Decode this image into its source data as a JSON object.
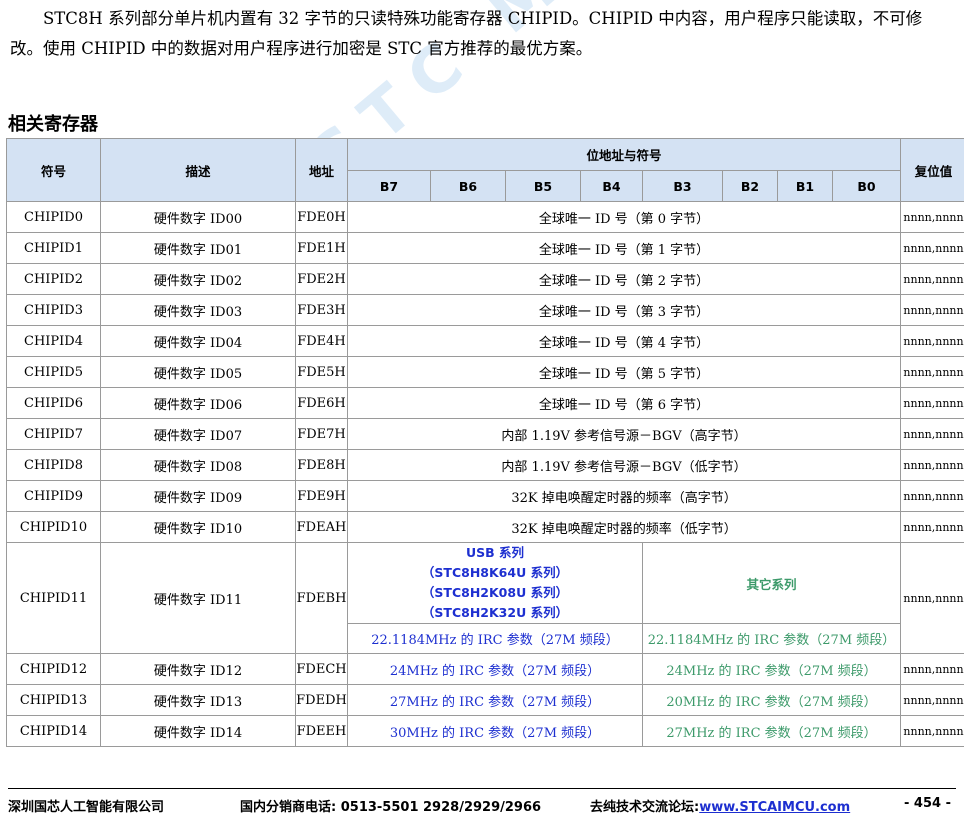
{
  "intro": "STC8H 系列部分单片机内置有 32 字节的只读特殊功能寄存器 CHIPID。CHIPID 中内容，用户程序只能读取，不可修改。使用 CHIPID 中的数据对用户程序进行加密是 STC 官方推荐的最优方案。",
  "watermark": "STC MCU",
  "section_title": "相关寄存器",
  "table": {
    "headers": {
      "symbol": "符号",
      "desc": "描述",
      "addr": "地址",
      "bits_group": "位地址与符号",
      "reset": "复位值",
      "bits": [
        "B7",
        "B6",
        "B5",
        "B4",
        "B3",
        "B2",
        "B1",
        "B0"
      ]
    },
    "rows": [
      {
        "symbol": "CHIPID0",
        "desc": "硬件数字 ID00",
        "addr": "FDE0H",
        "content": "全球唯一 ID 号（第 0 字节）",
        "reset": "nnnn,nnnn"
      },
      {
        "symbol": "CHIPID1",
        "desc": "硬件数字 ID01",
        "addr": "FDE1H",
        "content": "全球唯一 ID 号（第 1 字节）",
        "reset": "nnnn,nnnn"
      },
      {
        "symbol": "CHIPID2",
        "desc": "硬件数字 ID02",
        "addr": "FDE2H",
        "content": "全球唯一 ID 号（第 2 字节）",
        "reset": "nnnn,nnnn"
      },
      {
        "symbol": "CHIPID3",
        "desc": "硬件数字 ID03",
        "addr": "FDE3H",
        "content": "全球唯一 ID 号（第 3 字节）",
        "reset": "nnnn,nnnn"
      },
      {
        "symbol": "CHIPID4",
        "desc": "硬件数字 ID04",
        "addr": "FDE4H",
        "content": "全球唯一 ID 号（第 4 字节）",
        "reset": "nnnn,nnnn"
      },
      {
        "symbol": "CHIPID5",
        "desc": "硬件数字 ID05",
        "addr": "FDE5H",
        "content": "全球唯一 ID 号（第 5 字节）",
        "reset": "nnnn,nnnn"
      },
      {
        "symbol": "CHIPID6",
        "desc": "硬件数字 ID06",
        "addr": "FDE6H",
        "content": "全球唯一 ID 号（第 6 字节）",
        "reset": "nnnn,nnnn"
      },
      {
        "symbol": "CHIPID7",
        "desc": "硬件数字 ID07",
        "addr": "FDE7H",
        "content": "内部 1.19V 参考信号源－BGV（高字节）",
        "reset": "nnnn,nnnn"
      },
      {
        "symbol": "CHIPID8",
        "desc": "硬件数字 ID08",
        "addr": "FDE8H",
        "content": "内部 1.19V 参考信号源－BGV（低字节）",
        "reset": "nnnn,nnnn"
      },
      {
        "symbol": "CHIPID9",
        "desc": "硬件数字 ID09",
        "addr": "FDE9H",
        "content": "32K 掉电唤醒定时器的频率（高字节）",
        "reset": "nnnn,nnnn"
      },
      {
        "symbol": "CHIPID10",
        "desc": "硬件数字 ID10",
        "addr": "FDEAH",
        "content": "32K 掉电唤醒定时器的频率（低字节）",
        "reset": "nnnn,nnnn"
      }
    ],
    "row11": {
      "symbol": "CHIPID11",
      "desc": "硬件数字 ID11",
      "addr": "FDEBH",
      "reset": "nnnn,nnnn",
      "usb_title": "USB 系列",
      "usb_models": [
        "（STC8H8K64U 系列）",
        "（STC8H2K08U 系列）",
        "（STC8H2K32U 系列）"
      ],
      "other_title": "其它系列",
      "usb_value": "22.1184MHz 的 IRC 参数（27M 频段）",
      "other_value": "22.1184MHz 的 IRC 参数（27M 频段）"
    },
    "split_rows": [
      {
        "symbol": "CHIPID12",
        "desc": "硬件数字 ID12",
        "addr": "FDECH",
        "usb": "24MHz 的 IRC 参数（27M 频段）",
        "other": "24MHz 的 IRC 参数（27M 频段）",
        "reset": "nnnn,nnnn"
      },
      {
        "symbol": "CHIPID13",
        "desc": "硬件数字 ID13",
        "addr": "FDEDH",
        "usb": "27MHz 的 IRC 参数（27M 频段）",
        "other": "20MHz 的 IRC 参数（27M 频段）",
        "reset": "nnnn,nnnn"
      },
      {
        "symbol": "CHIPID14",
        "desc": "硬件数字 ID14",
        "addr": "FDEEH",
        "usb": "30MHz 的 IRC 参数（27M 频段）",
        "other": "27MHz 的 IRC 参数（27M 频段）",
        "reset": "nnnn,nnnn"
      }
    ]
  },
  "footer": {
    "company": "深圳国芯人工智能有限公司",
    "phone": "国内分销商电话: 0513-5501 2928/2929/2966",
    "forum_label": "去纯技术交流论坛:",
    "forum_url": "www.STCAIMCU.com",
    "page": "- 454 -"
  },
  "colors": {
    "header_bg": "#d4e2f3",
    "usb_text": "#1d2fd0",
    "other_text": "#3d9a6a"
  }
}
